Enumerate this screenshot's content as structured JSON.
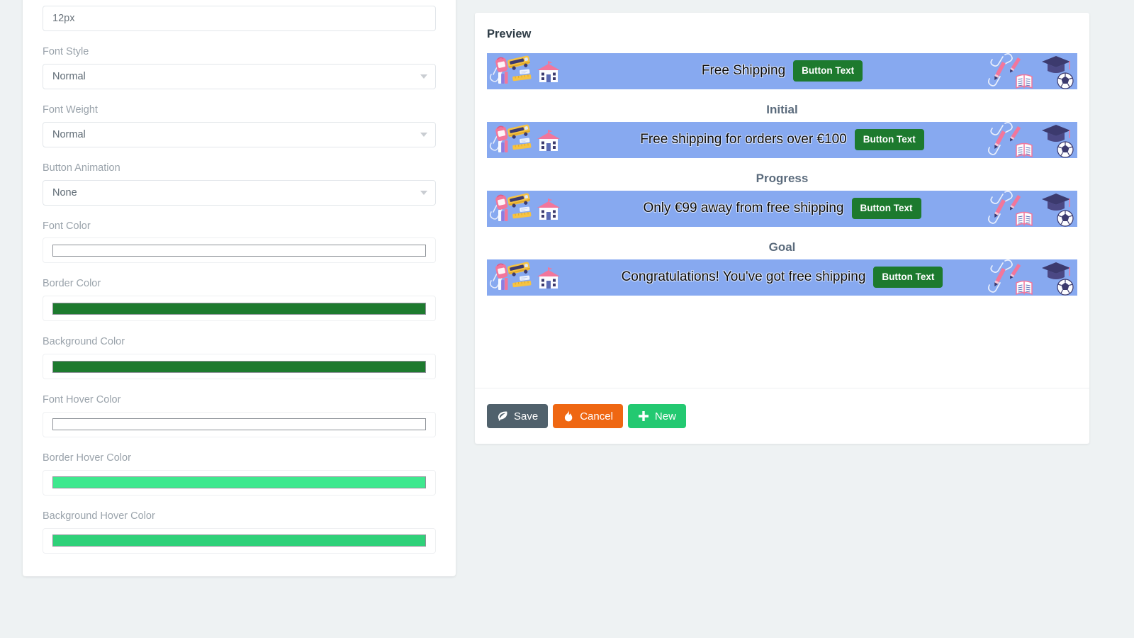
{
  "settings": {
    "fields": [
      {
        "name": "font-size",
        "label": "",
        "type": "text",
        "value": "12px"
      },
      {
        "name": "font-style",
        "label": "Font Style",
        "type": "select",
        "value": "Normal"
      },
      {
        "name": "font-weight",
        "label": "Font Weight",
        "type": "select",
        "value": "Normal"
      },
      {
        "name": "button-animation",
        "label": "Button Animation",
        "type": "select",
        "value": "None"
      },
      {
        "name": "font-color",
        "label": "Font Color",
        "type": "color",
        "value": "#ffffff"
      },
      {
        "name": "border-color",
        "label": "Border Color",
        "type": "color",
        "value": "#1d7a2e"
      },
      {
        "name": "background-color",
        "label": "Background Color",
        "type": "color",
        "value": "#1d7a2e"
      },
      {
        "name": "font-hover-color",
        "label": "Font Hover Color",
        "type": "color",
        "value": "#ffffff"
      },
      {
        "name": "border-hover-color",
        "label": "Border Hover Color",
        "type": "color",
        "value": "#3ee88e"
      },
      {
        "name": "background-hover-color",
        "label": "Background Hover Color",
        "type": "color",
        "value": "#2fd179"
      }
    ]
  },
  "preview": {
    "title": "Preview",
    "bar_style": {
      "background": "#87a9f0",
      "text_color": "#0b0b0b",
      "button_background": "#1d7a2e",
      "button_text_color": "#ffffff"
    },
    "banners": [
      {
        "state_label": "",
        "text": "Free Shipping",
        "button_label": "Button Text"
      },
      {
        "state_label": "Initial",
        "text": "Free shipping for orders over €100",
        "button_label": "Button Text"
      },
      {
        "state_label": "Progress",
        "text": "Only €99 away from free shipping",
        "button_label": "Button Text"
      },
      {
        "state_label": "Goal",
        "text": "Congratulations! You've got free shipping",
        "button_label": "Button Text"
      }
    ],
    "actions": [
      {
        "name": "save",
        "label": "Save",
        "icon": "leaf-icon",
        "color": "#50616c"
      },
      {
        "name": "cancel",
        "label": "Cancel",
        "icon": "flame-icon",
        "color": "#ef6712"
      },
      {
        "name": "new",
        "label": "New",
        "icon": "plus-icon",
        "color": "#23c971"
      }
    ]
  }
}
